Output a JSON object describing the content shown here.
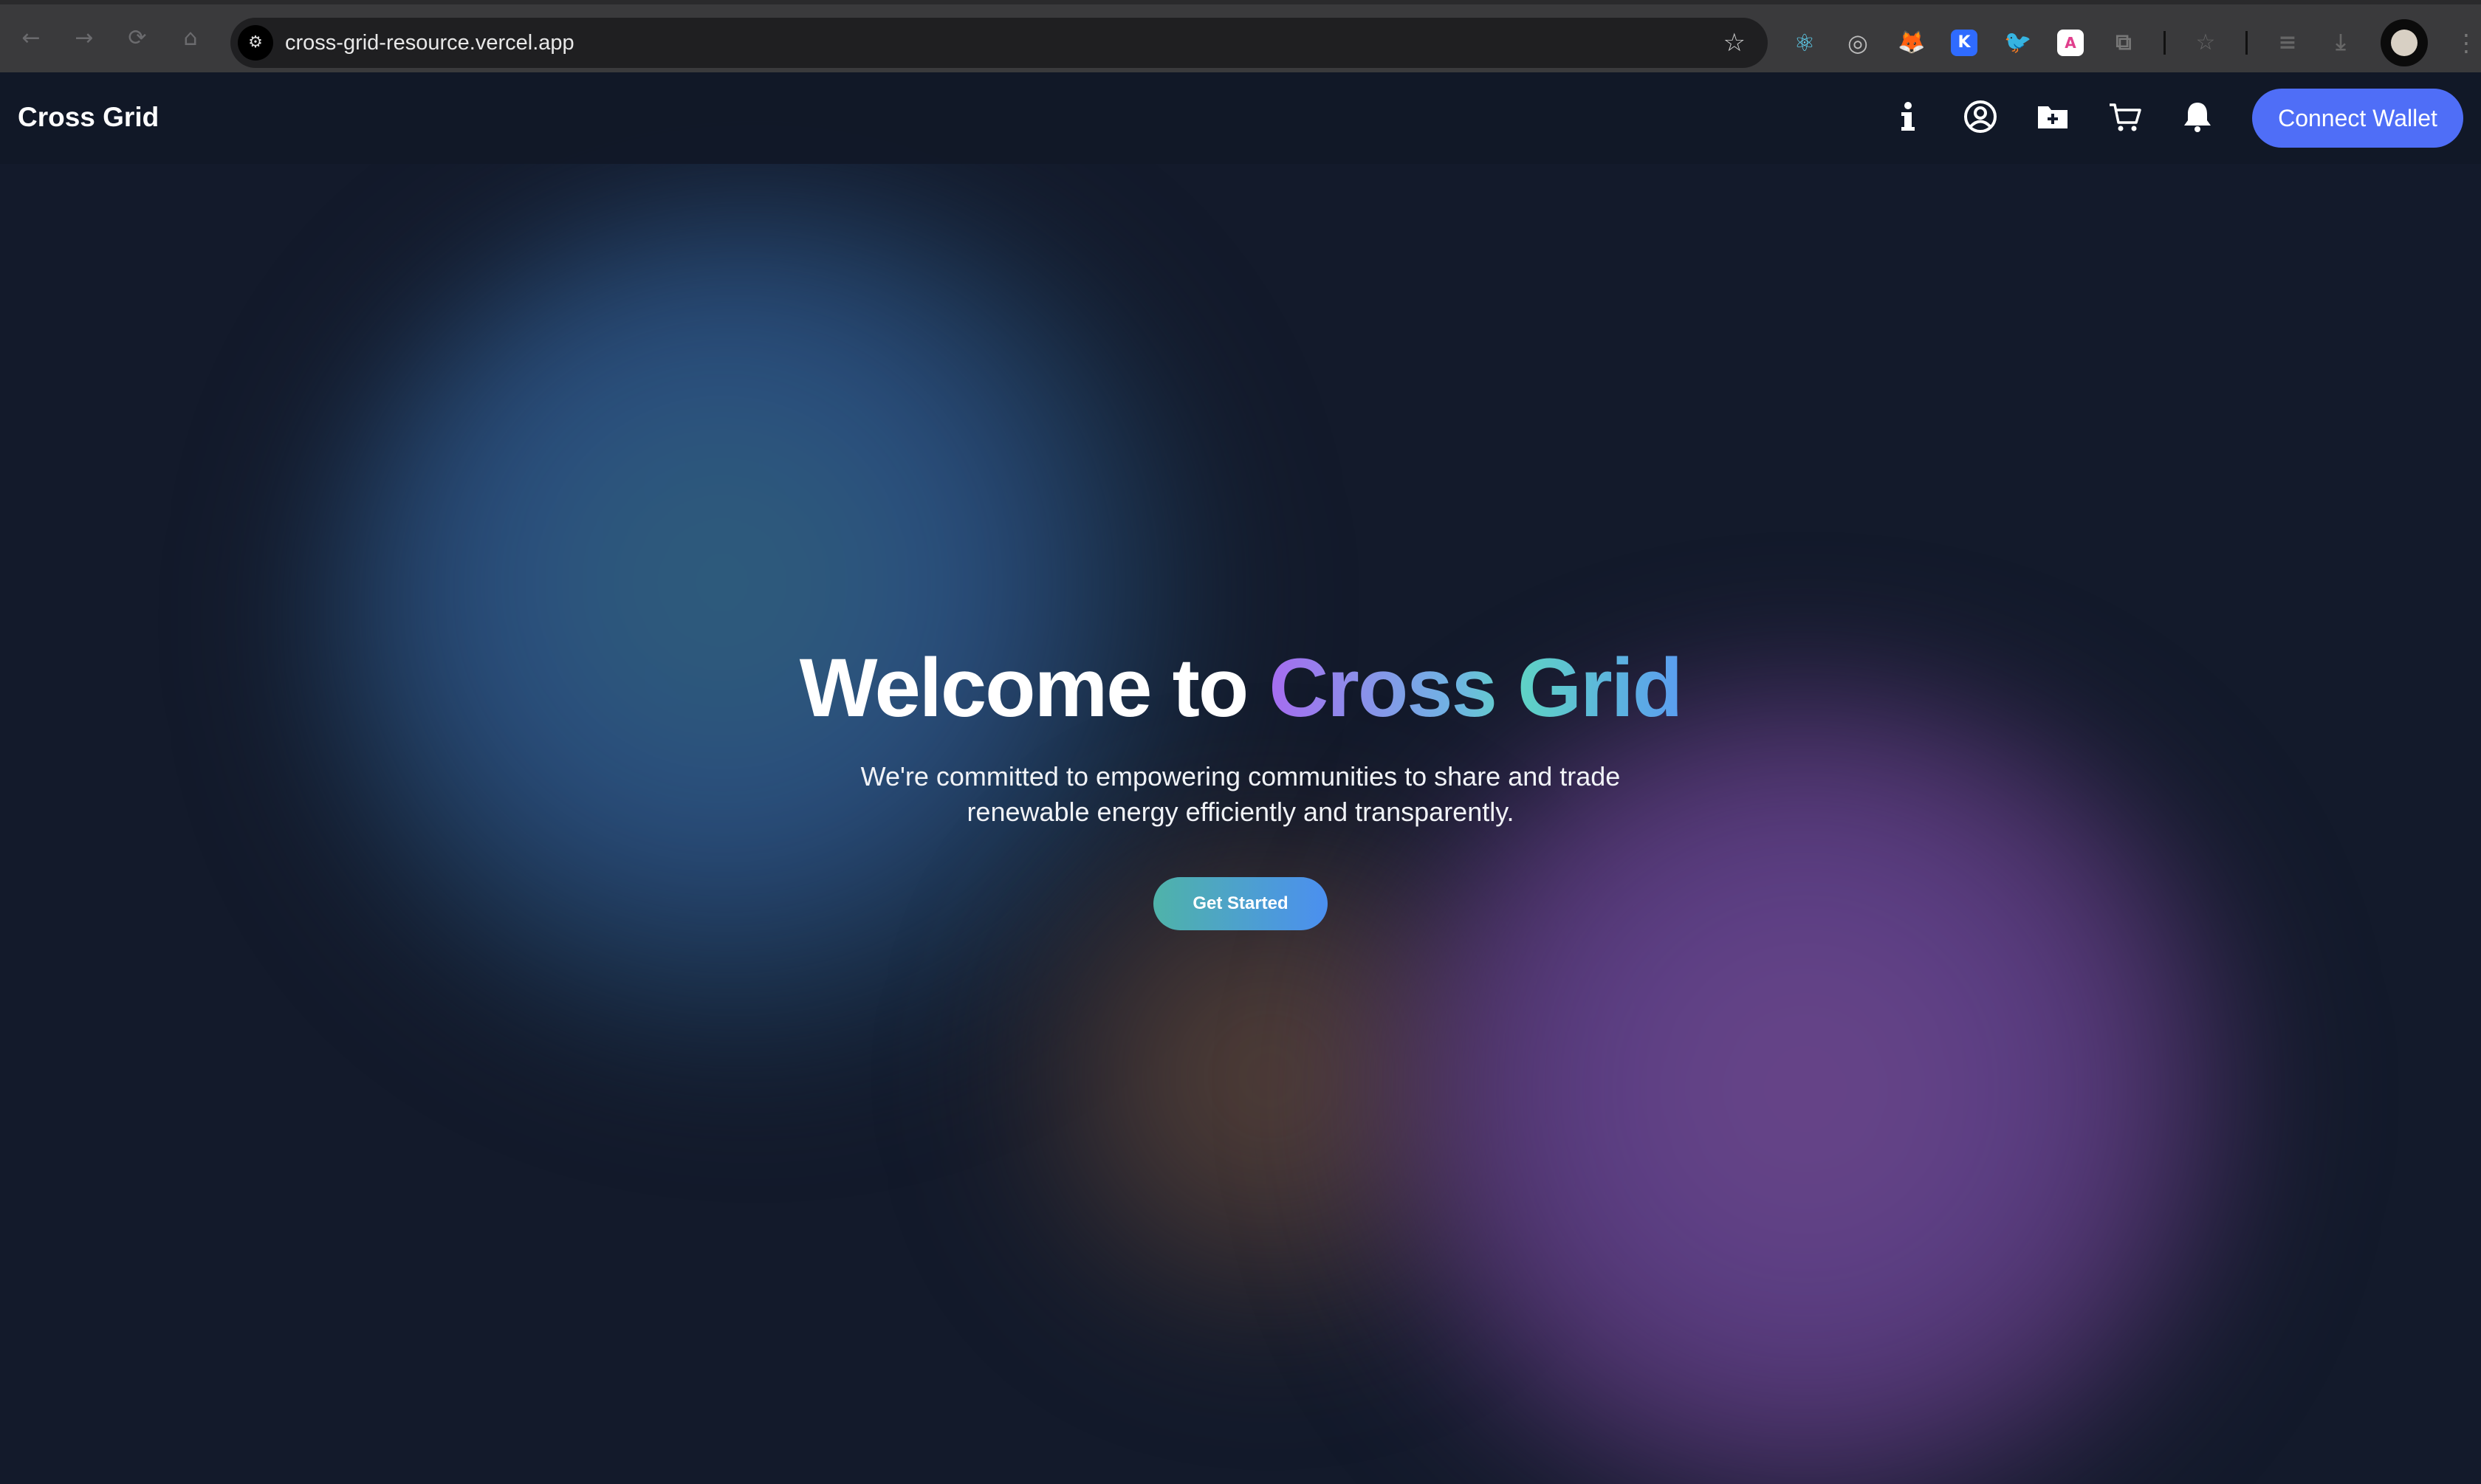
{
  "browser": {
    "url": "cross-grid-resource.vercel.app",
    "nav": {
      "back_icon": "←",
      "forward_icon": "→",
      "reload_icon": "⟳",
      "home_icon": "⌂"
    },
    "site_info_icon": "⚙",
    "bookmark_icon": "☆",
    "extensions": [
      {
        "name": "react-devtools-icon",
        "glyph": "⚛"
      },
      {
        "name": "target-extension-icon",
        "glyph": "◎"
      },
      {
        "name": "metamask-fox-icon",
        "glyph": "🦊"
      },
      {
        "name": "k-extension-icon",
        "glyph": "K"
      },
      {
        "name": "bird-extension-icon",
        "glyph": "🐦"
      },
      {
        "name": "pdf-extension-icon",
        "glyph": "A"
      },
      {
        "name": "extensions-puzzle-icon",
        "glyph": "⧉"
      }
    ],
    "reading_list_icon": "☆",
    "playlist_icon": "≡",
    "download_icon": "⤓",
    "menu_icon": "⋮"
  },
  "header": {
    "brand": "Cross Grid",
    "icons": [
      "info-icon",
      "user-circle-icon",
      "folder-plus-icon",
      "cart-icon",
      "bell-icon"
    ],
    "connect_wallet": "Connect Wallet"
  },
  "hero": {
    "title_prefix": "Welcome to ",
    "title_accent": "Cross Grid",
    "subtitle_line1": "We're committed to empowering communities to share and trade",
    "subtitle_line2": "renewable energy efficiently and transparently.",
    "cta": "Get Started"
  },
  "colors": {
    "page_bg": "#131a2b",
    "header_bg": "#111827",
    "connect_button": "#4f6ef7",
    "cta_gradient_start": "#4fb3a9",
    "cta_gradient_end": "#4b8ff0",
    "accent_gradient": [
      "#a66cf0",
      "#5fd4c4",
      "#5b9df0"
    ]
  }
}
